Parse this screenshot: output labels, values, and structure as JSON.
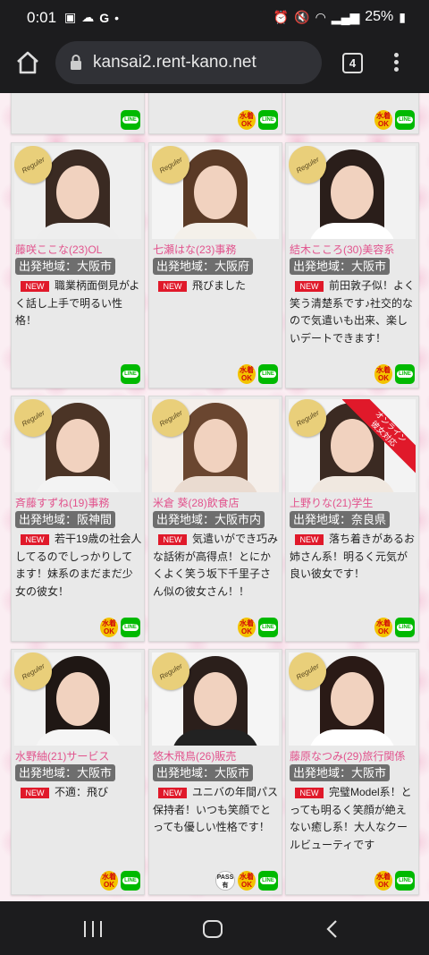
{
  "status": {
    "time": "0:01",
    "battery": "25%"
  },
  "browser": {
    "url": "kansai2.rent-kano.net",
    "tab_count": "4"
  },
  "badge_text": "Reguler",
  "new_label": "NEW",
  "line_label": "LINE",
  "swim_label": "水着OK",
  "pass_label": "PASS有",
  "online_label": "オンライン彼女対応",
  "cards": [
    {
      "name": "藤咲ここな(23)OL",
      "region": "出発地域：大阪市",
      "desc": "職業柄面倒見がよく話し上手で明るい性格！",
      "swim": false,
      "pass": false,
      "online": false
    },
    {
      "name": "七瀬はな(23)事務",
      "region": "出発地域：大阪府",
      "desc": "飛びました",
      "swim": true,
      "pass": false,
      "online": false
    },
    {
      "name": "結木こころ(30)美容系",
      "region": "出発地域：大阪市",
      "desc": "前田敦子似！よく笑う清楚系です♪社交的なので気遣いも出来、楽しいデートできます！",
      "swim": true,
      "pass": false,
      "online": false
    },
    {
      "name": "斉藤すずね(19)事務",
      "region": "出発地域：阪神間",
      "desc": "若干19歳の社会人してるのでしっかりしてます！妹系のまだまだ少女の彼女！",
      "swim": true,
      "pass": false,
      "online": false
    },
    {
      "name": "米倉 葵(28)飲食店",
      "region": "出発地域：大阪市内",
      "desc": "気遣いができ巧みな話術が高得点！とにかくよく笑う坂下千里子さん似の彼女さん！！",
      "swim": true,
      "pass": false,
      "online": false
    },
    {
      "name": "上野りな(21)学生",
      "region": "出発地域：奈良県",
      "desc": "落ち着きがあるお姉さん系！明るく元気が良い彼女です！",
      "swim": true,
      "pass": false,
      "online": true
    },
    {
      "name": "水野紬(21)サービス",
      "region": "出発地域：大阪市",
      "desc": "不適：飛び",
      "swim": true,
      "pass": false,
      "online": false
    },
    {
      "name": "悠木飛鳥(26)販売",
      "region": "出発地域：大阪市",
      "desc": "ユニバの年間パス保持者！いつも笑顔でとっても優しい性格です！",
      "swim": true,
      "pass": true,
      "online": false
    },
    {
      "name": "藤原なつみ(29)旅行関係",
      "region": "出発地域：大阪市",
      "desc": "完璧Model系！とっても明るく笑顔が絶えない癒し系！大人なクールビューティです",
      "swim": true,
      "pass": false,
      "online": false
    }
  ],
  "top_row": [
    {
      "swim": false
    },
    {
      "swim": true
    },
    {
      "swim": true
    }
  ]
}
